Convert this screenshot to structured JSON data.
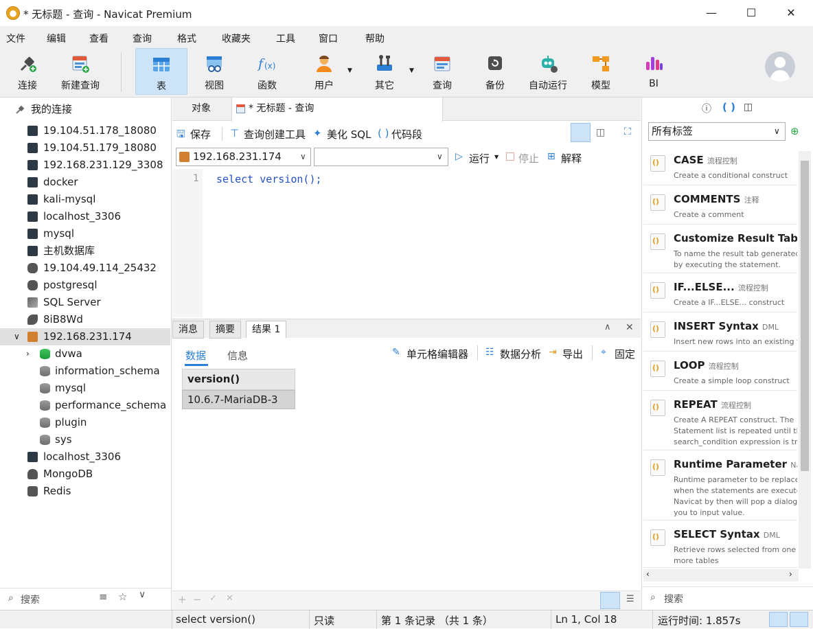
{
  "window": {
    "title": "* 无标题 - 查询 - Navicat Premium"
  },
  "menu": [
    "文件",
    "编辑",
    "查看",
    "查询",
    "格式",
    "收藏夹",
    "工具",
    "窗口",
    "帮助"
  ],
  "toolbar": {
    "connect": "连接",
    "new_query": "新建查询",
    "table": "表",
    "view": "视图",
    "function": "函数",
    "user": "用户",
    "other": "其它",
    "query": "查询",
    "backup": "备份",
    "automation": "自动运行",
    "model": "模型",
    "bi": "BI"
  },
  "sidebar": {
    "root": "我的连接",
    "items": [
      "19.104.51.178_18080",
      "19.104.51.179_18080",
      "192.168.231.129_3308",
      "docker",
      "kali-mysql",
      "localhost_3306",
      "mysql",
      "主机数据库",
      "19.104.49.114_25432",
      "postgresql",
      "SQL Server",
      "8iB8Wd",
      "192.168.231.174"
    ],
    "databases": [
      "dvwa",
      "information_schema",
      "mysql",
      "performance_schema",
      "plugin",
      "sys"
    ],
    "after": [
      "localhost_3306",
      "MongoDB",
      "Redis"
    ],
    "search_placeholder": "搜索"
  },
  "tabs": {
    "objects": "对象",
    "query_tab": "* 无标题 - 查询"
  },
  "query_toolbar": {
    "save": "保存",
    "builder": "查询创建工具",
    "beautify": "美化 SQL",
    "snippet": "代码段",
    "connection": "192.168.231.174",
    "database": "",
    "run": "运行",
    "stop": "停止",
    "explain": "解释"
  },
  "editor": {
    "line_no": "1",
    "kw": "select",
    "rest": " version();"
  },
  "result_tabs": {
    "messages": "消息",
    "summary": "摘要",
    "result1": "结果 1"
  },
  "result_sub": {
    "data": "数据",
    "info": "信息",
    "cell_editor": "单元格编辑器",
    "analysis": "数据分析",
    "export": "导出",
    "pin": "固定"
  },
  "grid": {
    "header": "version()",
    "value": "10.6.7-MariaDB-3"
  },
  "right_panel": {
    "tag_select": "所有标签",
    "snippets": [
      {
        "name": "CASE",
        "cat": "流程控制",
        "desc": "Create a conditional construct"
      },
      {
        "name": "COMMENTS",
        "cat": "注释",
        "desc": "Create a comment"
      },
      {
        "name": "Customize Result Tab",
        "cat": "",
        "desc": "To name the result tab generated by executing the statement."
      },
      {
        "name": "IF...ELSE...",
        "cat": "流程控制",
        "desc": "Create a IF...ELSE... construct"
      },
      {
        "name": "INSERT Syntax",
        "cat": "DML",
        "desc": "Insert new rows into an existing table"
      },
      {
        "name": "LOOP",
        "cat": "流程控制",
        "desc": "Create a simple loop construct"
      },
      {
        "name": "REPEAT",
        "cat": "流程控制",
        "desc": "Create A REPEAT construct. The Statement list is repeated until the search_condition expression is true."
      },
      {
        "name": "Runtime Parameter",
        "cat": "Nav",
        "desc": "Runtime parameter to be replaced when the statements are executed. Navicat by then will pop a dialog for you to input value."
      },
      {
        "name": "SELECT Syntax",
        "cat": "DML",
        "desc": "Retrieve rows selected from one or more tables"
      }
    ],
    "search_placeholder": "搜索"
  },
  "status": {
    "sql": "select version()",
    "readonly": "只读",
    "records": "第 1 条记录 （共 1 条）",
    "position": "Ln 1, Col 18",
    "runtime": "运行时间: 1.857s"
  },
  "colors": {
    "accent": "#1a73d9",
    "active_tool": "#cde3f7",
    "keyword": "#2250c8"
  }
}
